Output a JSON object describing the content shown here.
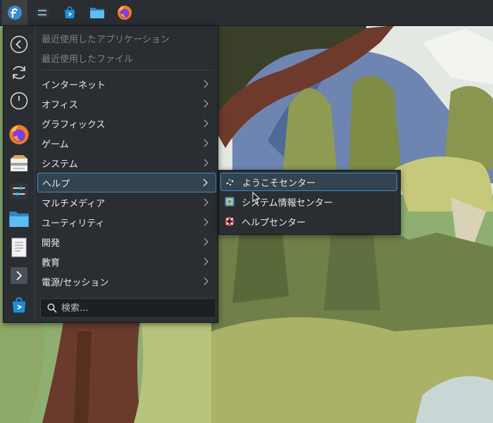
{
  "taskbar": {
    "items": [
      {
        "name": "fedora-launcher-icon",
        "active": true
      },
      {
        "name": "system-settings-icon",
        "active": false
      },
      {
        "name": "discover-store-icon",
        "active": false
      },
      {
        "name": "file-manager-icon",
        "active": false
      },
      {
        "name": "firefox-icon",
        "active": false
      }
    ]
  },
  "launcher": {
    "sidebar": [
      {
        "name": "back-icon",
        "tooltip": ""
      },
      {
        "name": "refresh-icon"
      },
      {
        "name": "power-icon"
      },
      {
        "name": "firefox-icon"
      },
      {
        "name": "package-installer-icon"
      },
      {
        "name": "system-settings-icon"
      },
      {
        "name": "file-manager-icon"
      },
      {
        "name": "text-document-icon"
      },
      {
        "name": "expand-arrow-icon"
      },
      {
        "name": "discover-store-icon"
      }
    ],
    "recent": [
      {
        "label": "最近使用したアプリケーション"
      },
      {
        "label": "最近使用したファイル"
      }
    ],
    "categories": [
      {
        "label": "インターネット"
      },
      {
        "label": "オフィス"
      },
      {
        "label": "グラフィックス"
      },
      {
        "label": "ゲーム"
      },
      {
        "label": "システム"
      },
      {
        "label": "ヘルプ",
        "highlighted": true
      },
      {
        "label": "マルチメディア"
      },
      {
        "label": "ユーティリティ"
      },
      {
        "label": "開発"
      },
      {
        "label": "教育"
      },
      {
        "label": "電源/セッション"
      }
    ],
    "search": {
      "placeholder": "検索..."
    }
  },
  "submenu": {
    "items": [
      {
        "label": "ようこそセンター",
        "icon": "welcome-icon",
        "highlighted": true
      },
      {
        "label": "システム情報センター",
        "icon": "info-center-icon"
      },
      {
        "label": "ヘルプセンター",
        "icon": "lifebuoy-icon"
      }
    ]
  },
  "colors": {
    "panel": "#2a2e32",
    "highlight_bg": "#334350",
    "highlight_border": "#3d8bc7",
    "accent": "#3daee9"
  }
}
